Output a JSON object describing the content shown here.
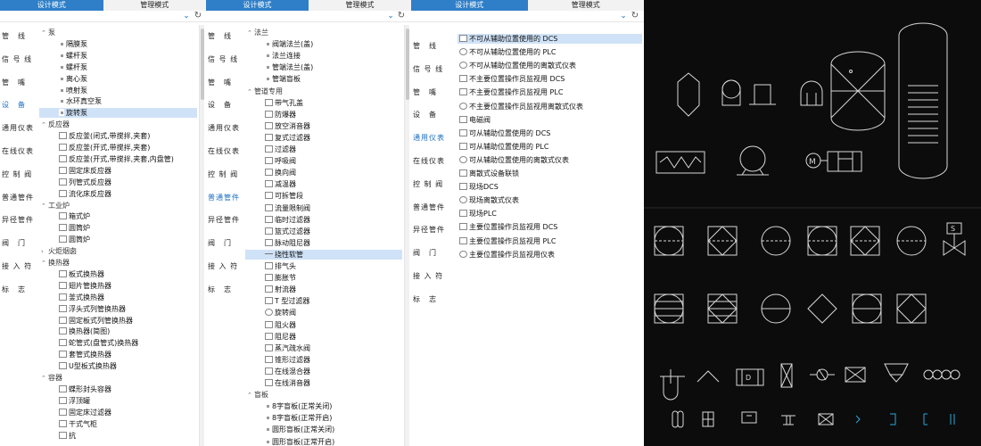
{
  "tabs": {
    "design": "设计模式",
    "manage": "管理模式"
  },
  "sidebar": [
    "管　线",
    "信 号 线",
    "管　嘴",
    "设　备",
    "通用仪表",
    "在线仪表",
    "控 制 阀",
    "普通管件",
    "异径管件",
    "阀　门",
    "接 入 符",
    "标　志"
  ],
  "panel1": {
    "active_side": "设　备",
    "rows": [
      {
        "t": "泵",
        "lv": 0,
        "g": true
      },
      {
        "t": "隔膜泵",
        "lv": 2,
        "i": "dot"
      },
      {
        "t": "螺杆泵",
        "lv": 2,
        "i": "dot"
      },
      {
        "t": "螺杆泵",
        "lv": 2,
        "i": "dot"
      },
      {
        "t": "离心泵",
        "lv": 2,
        "i": "dot"
      },
      {
        "t": "喷射泵",
        "lv": 2,
        "i": "dot"
      },
      {
        "t": "水环真空泵",
        "lv": 2,
        "i": "dot"
      },
      {
        "t": "旋转泵",
        "lv": 2,
        "i": "dot",
        "sel": true
      },
      {
        "t": "反应器",
        "lv": 0,
        "g": true
      },
      {
        "t": "反应釜(闭式,带搅拌,夹套)",
        "lv": 2,
        "i": "box"
      },
      {
        "t": "反应釜(开式,带搅拌,夹套)",
        "lv": 2,
        "i": "box"
      },
      {
        "t": "反应釜(开式,带搅拌,夹套,内盘管)",
        "lv": 2,
        "i": "box"
      },
      {
        "t": "固定床反应器",
        "lv": 2,
        "i": "box"
      },
      {
        "t": "列管式反应器",
        "lv": 2,
        "i": "box"
      },
      {
        "t": "流化床反应器",
        "lv": 2,
        "i": "box"
      },
      {
        "t": "工业炉",
        "lv": 0,
        "g": true
      },
      {
        "t": "箱式炉",
        "lv": 2,
        "i": "box"
      },
      {
        "t": "圆筒炉",
        "lv": 2,
        "i": "box"
      },
      {
        "t": "圆筒炉",
        "lv": 2,
        "i": "box"
      },
      {
        "t": "火炬烟囱",
        "lv": 0,
        "g": true,
        "closed": true
      },
      {
        "t": "换热器",
        "lv": 0,
        "g": true
      },
      {
        "t": "板式换热器",
        "lv": 2,
        "i": "box"
      },
      {
        "t": "翅片管换热器",
        "lv": 2,
        "i": "box"
      },
      {
        "t": "釜式换热器",
        "lv": 2,
        "i": "box"
      },
      {
        "t": "浮头式列管换热器",
        "lv": 2,
        "i": "box"
      },
      {
        "t": "固定板式列管换热器",
        "lv": 2,
        "i": "box"
      },
      {
        "t": "换热器(简图)",
        "lv": 2,
        "i": "box"
      },
      {
        "t": "蛇管式(盘管式)换热器",
        "lv": 2,
        "i": "box"
      },
      {
        "t": "套管式换热器",
        "lv": 2,
        "i": "box"
      },
      {
        "t": "U型板式换热器",
        "lv": 2,
        "i": "box"
      },
      {
        "t": "容器",
        "lv": 0,
        "g": true
      },
      {
        "t": "蝶形封头容器",
        "lv": 2,
        "i": "box"
      },
      {
        "t": "浮顶罐",
        "lv": 2,
        "i": "box"
      },
      {
        "t": "固定床过滤器",
        "lv": 2,
        "i": "box"
      },
      {
        "t": "干式气柜",
        "lv": 2,
        "i": "box"
      },
      {
        "t": "抗",
        "lv": 2,
        "i": "box"
      }
    ]
  },
  "panel2": {
    "active_side": "普通管件",
    "rows": [
      {
        "t": "法兰",
        "lv": 0,
        "g": true
      },
      {
        "t": "阀端法兰(盖)",
        "lv": 2,
        "i": "dot"
      },
      {
        "t": "法兰连接",
        "lv": 2,
        "i": "dot"
      },
      {
        "t": "管端法兰(盖)",
        "lv": 2,
        "i": "dot"
      },
      {
        "t": "管端盲板",
        "lv": 2,
        "i": "dot"
      },
      {
        "t": "管道专用",
        "lv": 0,
        "g": true
      },
      {
        "t": "带气孔盖",
        "lv": 2,
        "i": "box"
      },
      {
        "t": "防爆器",
        "lv": 2,
        "i": "box"
      },
      {
        "t": "放空消音器",
        "lv": 2,
        "i": "box"
      },
      {
        "t": "复式过滤器",
        "lv": 2,
        "i": "box"
      },
      {
        "t": "过滤器",
        "lv": 2,
        "i": "box"
      },
      {
        "t": "呼吸阀",
        "lv": 2,
        "i": "box"
      },
      {
        "t": "换向阀",
        "lv": 2,
        "i": "box"
      },
      {
        "t": "减温器",
        "lv": 2,
        "i": "box"
      },
      {
        "t": "可拆管段",
        "lv": 2,
        "i": "box"
      },
      {
        "t": "流量限制阀",
        "lv": 2,
        "i": "box"
      },
      {
        "t": "临时过滤器",
        "lv": 2,
        "i": "box"
      },
      {
        "t": "篮式过滤器",
        "lv": 2,
        "i": "box"
      },
      {
        "t": "脉动阻尼器",
        "lv": 2,
        "i": "box"
      },
      {
        "t": "挠性软管",
        "lv": 2,
        "i": "line",
        "sel": true
      },
      {
        "t": "排气头",
        "lv": 2,
        "i": "box"
      },
      {
        "t": "膨胀节",
        "lv": 2,
        "i": "box"
      },
      {
        "t": "射流器",
        "lv": 2,
        "i": "box"
      },
      {
        "t": "T 型过滤器",
        "lv": 2,
        "i": "box"
      },
      {
        "t": "旋转阀",
        "lv": 2,
        "i": "circ"
      },
      {
        "t": "阻火器",
        "lv": 2,
        "i": "box"
      },
      {
        "t": "阻尼器",
        "lv": 2,
        "i": "box"
      },
      {
        "t": "蒸汽疏水阀",
        "lv": 2,
        "i": "box"
      },
      {
        "t": "锥形过滤器",
        "lv": 2,
        "i": "box"
      },
      {
        "t": "在线混合器",
        "lv": 2,
        "i": "box"
      },
      {
        "t": "在线消音器",
        "lv": 2,
        "i": "box"
      },
      {
        "t": "盲板",
        "lv": 0,
        "g": true
      },
      {
        "t": "8字盲板(正常关闭)",
        "lv": 2,
        "i": "dot"
      },
      {
        "t": "8字盲板(正常开启)",
        "lv": 2,
        "i": "dot"
      },
      {
        "t": "圆形盲板(正常关闭)",
        "lv": 2,
        "i": "dot"
      },
      {
        "t": "圆形盲板(正常开启)",
        "lv": 2,
        "i": "dot"
      }
    ]
  },
  "panel3": {
    "active_side": "通用仪表",
    "rows": [
      {
        "t": "不可从辅助位置使用的 DCS",
        "i": "box",
        "sel": true
      },
      {
        "t": "不可从辅助位置使用的 PLC",
        "i": "circ"
      },
      {
        "t": "不可从辅助位置使用的离散式仪表",
        "i": "circ"
      },
      {
        "t": "不主要位置操作员监视用 DCS",
        "i": "box"
      },
      {
        "t": "不主要位置操作员监视用 PLC",
        "i": "box"
      },
      {
        "t": "不主要位置操作员监视用离散式仪表",
        "i": "circ"
      },
      {
        "t": "电磁阀",
        "i": "box"
      },
      {
        "t": "可从辅助位置使用的 DCS",
        "i": "box"
      },
      {
        "t": "可从辅助位置使用的 PLC",
        "i": "box"
      },
      {
        "t": "可从辅助位置使用的离散式仪表",
        "i": "circ"
      },
      {
        "t": "离散式设备联锁",
        "i": "box"
      },
      {
        "t": "现场DCS",
        "i": "box"
      },
      {
        "t": "现场离散式仪表",
        "i": "circ"
      },
      {
        "t": "现场PLC",
        "i": "box"
      },
      {
        "t": "主要位置操作员监视用 DCS",
        "i": "box"
      },
      {
        "t": "主要位置操作员监视用 PLC",
        "i": "box"
      },
      {
        "t": "主要位置操作员监视用仪表",
        "i": "circ"
      }
    ]
  },
  "colors": {
    "active_tab": "#2f7fc8",
    "active_side": "#1a6fc2",
    "selection": "#cfe2f7",
    "cad_bg": "#0c0c0c",
    "cad_line": "#d8d8d8",
    "cad_accent": "#2aa7d8"
  }
}
